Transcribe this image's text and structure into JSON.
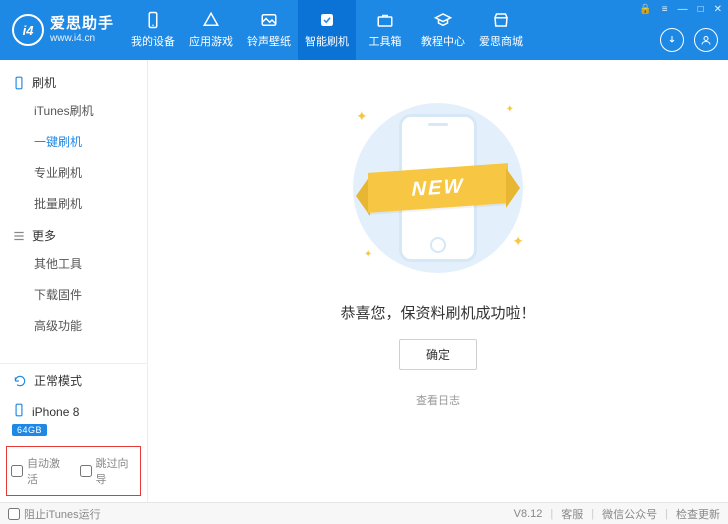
{
  "brand": {
    "name": "爱思助手",
    "url": "www.i4.cn",
    "logo_text": "i4"
  },
  "nav": [
    {
      "label": "我的设备"
    },
    {
      "label": "应用游戏"
    },
    {
      "label": "铃声壁纸"
    },
    {
      "label": "智能刷机",
      "active": true
    },
    {
      "label": "工具箱"
    },
    {
      "label": "教程中心"
    },
    {
      "label": "爱思商城"
    }
  ],
  "sidebar": {
    "group1": {
      "title": "刷机",
      "items": [
        "iTunes刷机",
        "一键刷机",
        "专业刷机",
        "批量刷机"
      ],
      "activeIndex": 1
    },
    "group2": {
      "title": "更多",
      "items": [
        "其他工具",
        "下载固件",
        "高级功能"
      ]
    }
  },
  "status": {
    "mode": "正常模式",
    "device_name": "iPhone 8",
    "device_badge": "64GB"
  },
  "options": {
    "auto_activate": "自动激活",
    "skip_guide": "跳过向导"
  },
  "main": {
    "ribbon": "NEW",
    "message": "恭喜您，保资料刷机成功啦！",
    "ok": "确定",
    "view_log": "查看日志"
  },
  "footer": {
    "block_itunes": "阻止iTunes运行",
    "version": "V8.12",
    "support": "客服",
    "wechat": "微信公众号",
    "check_update": "检查更新"
  }
}
